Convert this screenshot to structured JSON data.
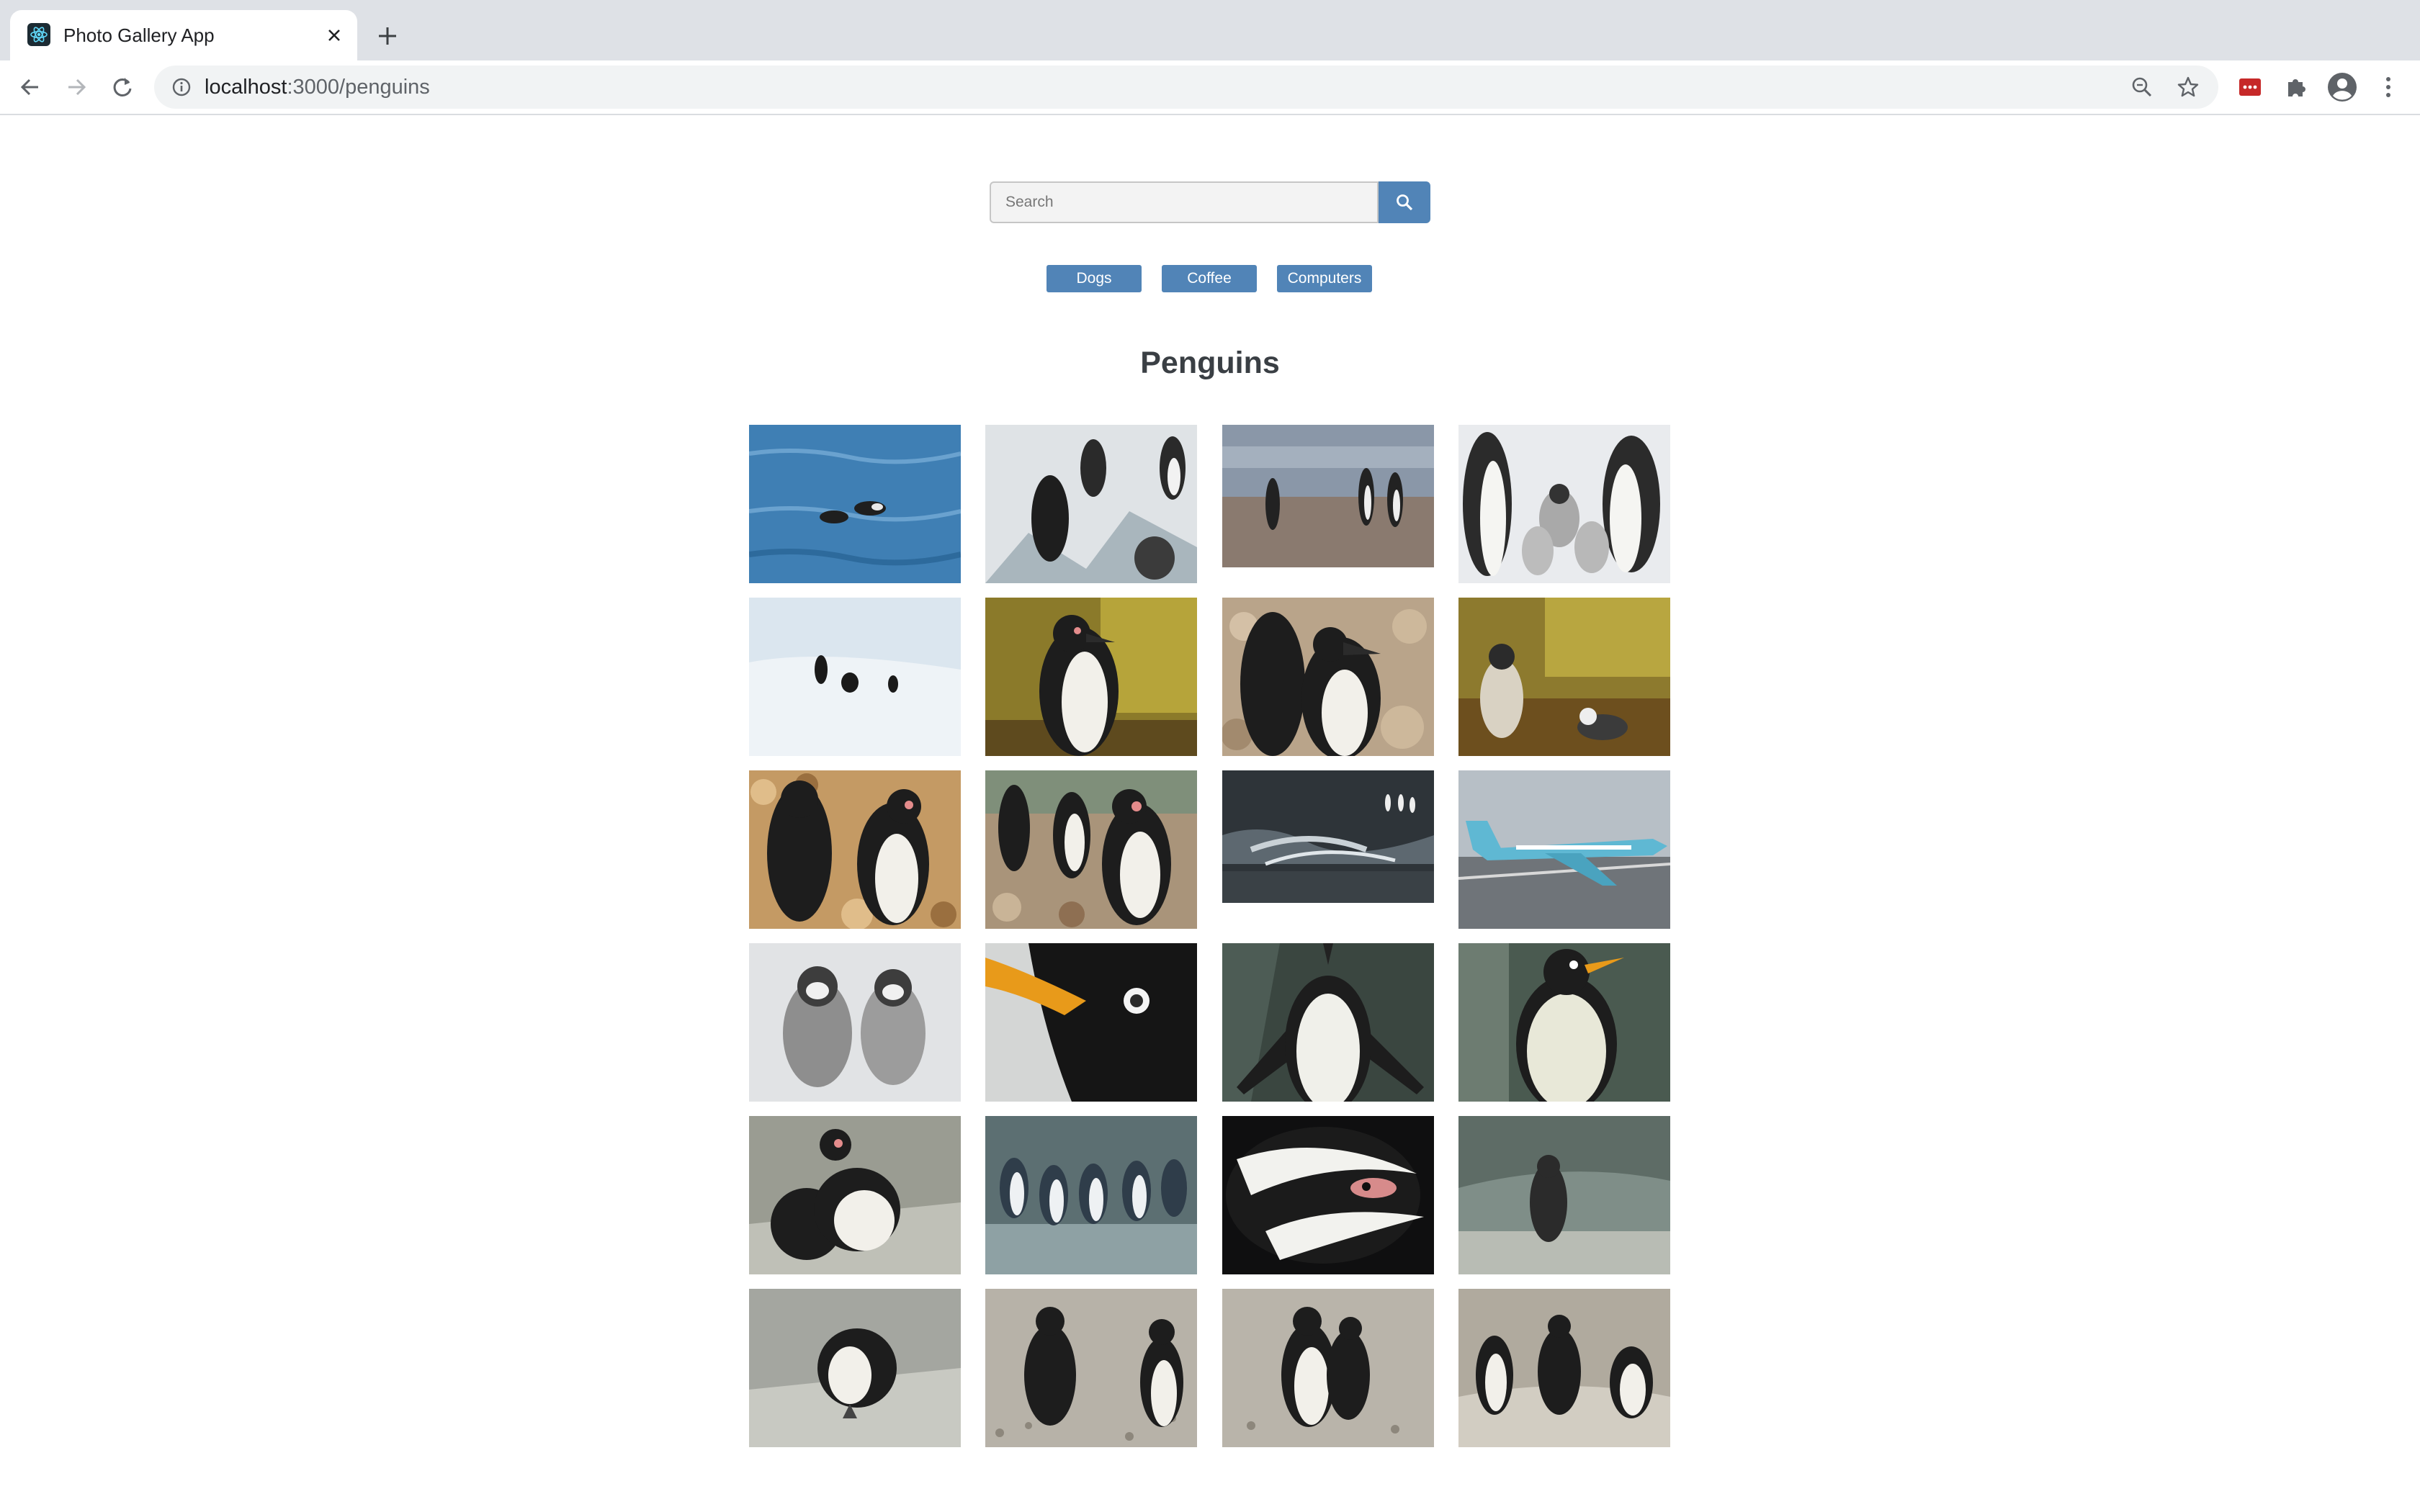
{
  "browser": {
    "tab_title": "Photo Gallery App",
    "url_host": "localhost",
    "url_path": ":3000/penguins"
  },
  "search": {
    "placeholder": "Search"
  },
  "categories": [
    "Dogs",
    "Coffee",
    "Computers"
  ],
  "page": {
    "title": "Penguins"
  },
  "photos": [
    {
      "subject": "penguins swimming in blue water"
    },
    {
      "subject": "penguins on ice"
    },
    {
      "subject": "penguins standing on shore"
    },
    {
      "subject": "emperor penguins with chicks"
    },
    {
      "subject": "penguins on snow"
    },
    {
      "subject": "humboldt penguin by mossy rock"
    },
    {
      "subject": "humboldt penguins on rocks"
    },
    {
      "subject": "penguins by pond"
    },
    {
      "subject": "two humboldt penguins on pebbles"
    },
    {
      "subject": "penguin group on pebbles"
    },
    {
      "subject": "penguins by dark water"
    },
    {
      "subject": "light blue jet on runway"
    },
    {
      "subject": "two fluffy penguin chicks"
    },
    {
      "subject": "gentoo penguin head close-up"
    },
    {
      "subject": "penguin stretching flippers"
    },
    {
      "subject": "gentoo penguin portrait"
    },
    {
      "subject": "humboldt penguins preening"
    },
    {
      "subject": "little blue penguins in a row"
    },
    {
      "subject": "humboldt penguin face close-up"
    },
    {
      "subject": "penguin standing on rock"
    },
    {
      "subject": "penguin preening on rock"
    },
    {
      "subject": "two penguins on gravel"
    },
    {
      "subject": "penguin pair on gravel"
    },
    {
      "subject": "three penguins on rock"
    }
  ]
}
